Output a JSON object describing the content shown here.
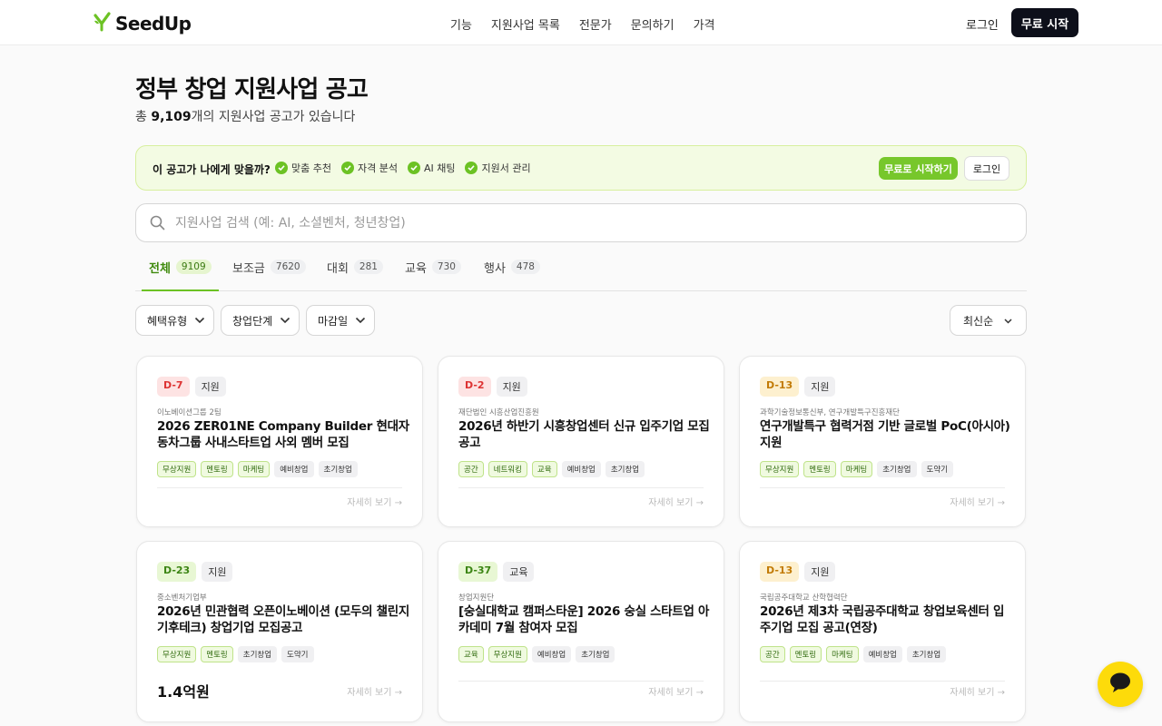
{
  "header": {
    "brand": "SeedUp",
    "nav": [
      "기능",
      "지원사업 목록",
      "전문가",
      "문의하기",
      "가격"
    ],
    "login": "로그인",
    "start": "무료 시작"
  },
  "page": {
    "title": "정부 창업 지원사업 공고",
    "subtitle_prefix": "총 ",
    "subtitle_count": "9,109",
    "subtitle_suffix": "개의 지원사업 공고가 있습니다"
  },
  "promo": {
    "question": "이 공고가 나에게 맞을까?",
    "features": [
      "맞춤 추천",
      "자격 분석",
      "AI 채팅",
      "지원서 관리"
    ],
    "start": "무료로 시작하기",
    "login": "로그인"
  },
  "search": {
    "placeholder": "지원사업 검색 (예: AI, 소셜벤처, 청년창업)"
  },
  "tabs": [
    {
      "label": "전체",
      "count": "9109"
    },
    {
      "label": "보조금",
      "count": "7620"
    },
    {
      "label": "대회",
      "count": "281"
    },
    {
      "label": "교육",
      "count": "730"
    },
    {
      "label": "행사",
      "count": "478"
    }
  ],
  "filters": [
    "혜택유형",
    "창업단계",
    "마감일"
  ],
  "sort": "최신순",
  "colors": {
    "accent": "#6cc224",
    "accent_dark": "#3f8a0d",
    "primary_button": "#0d0f1a",
    "chat": "#fddb0a"
  },
  "cards": [
    {
      "dday": "D-7",
      "dday_color": "red",
      "category": "지원",
      "org": "이노베이션그룹 2팀",
      "title": "2026 ZER01NE Company Builder 현대자동차그룹 사내스타트업 사외 멤버 모집",
      "tags": [
        {
          "t": "무상지원",
          "g": true
        },
        {
          "t": "멘토링",
          "g": true
        },
        {
          "t": "마케팅",
          "g": true
        },
        {
          "t": "예비창업",
          "g": false
        },
        {
          "t": "초기창업",
          "g": false
        }
      ],
      "more": "자세히 보기 →"
    },
    {
      "dday": "D-2",
      "dday_color": "red",
      "category": "지원",
      "org": "재단법인 시흥산업진흥원",
      "title": "2026년 하반기 시흥창업센터 신규 입주기업 모집 공고",
      "tags": [
        {
          "t": "공간",
          "g": true
        },
        {
          "t": "네트워킹",
          "g": true
        },
        {
          "t": "교육",
          "g": true
        },
        {
          "t": "예비창업",
          "g": false
        },
        {
          "t": "초기창업",
          "g": false
        }
      ],
      "more": "자세히 보기 →"
    },
    {
      "dday": "D-13",
      "dday_color": "orange",
      "category": "지원",
      "org": "과학기술정보통신부, 연구개발특구진흥재단",
      "title": "연구개발특구 협력거점 기반 글로벌 PoC(아시아) 지원",
      "tags": [
        {
          "t": "무상지원",
          "g": true
        },
        {
          "t": "멘토링",
          "g": true
        },
        {
          "t": "마케팅",
          "g": true
        },
        {
          "t": "초기창업",
          "g": false
        },
        {
          "t": "도약기",
          "g": false
        }
      ],
      "more": "자세히 보기 →"
    },
    {
      "dday": "D-23",
      "dday_color": "green",
      "category": "지원",
      "org": "중소벤처기업부",
      "title": "2026년 민관협력 오픈이노베이션 (모두의 챌린지 기후테크) 창업기업 모집공고",
      "tags": [
        {
          "t": "무상지원",
          "g": true
        },
        {
          "t": "멘토링",
          "g": true
        },
        {
          "t": "초기창업",
          "g": false
        },
        {
          "t": "도약기",
          "g": false
        }
      ],
      "amount": "1.4억원",
      "more": "자세히 보기 →"
    },
    {
      "dday": "D-37",
      "dday_color": "green",
      "category": "교육",
      "org": "창업지원단",
      "title": "[숭실대학교 캠퍼스타운] 2026 숭실 스타트업 아카데미 7월 참여자 모집",
      "tags": [
        {
          "t": "교육",
          "g": true
        },
        {
          "t": "무상지원",
          "g": true
        },
        {
          "t": "예비창업",
          "g": false
        },
        {
          "t": "초기창업",
          "g": false
        }
      ],
      "more": "자세히 보기 →"
    },
    {
      "dday": "D-13",
      "dday_color": "orange",
      "category": "지원",
      "org": "국립공주대학교 산학협력단",
      "title": "2026년 제3차 국립공주대학교 창업보육센터 입주기업 모집 공고(연장)",
      "tags": [
        {
          "t": "공간",
          "g": true
        },
        {
          "t": "멘토링",
          "g": true
        },
        {
          "t": "마케팅",
          "g": true
        },
        {
          "t": "예비창업",
          "g": false
        },
        {
          "t": "초기창업",
          "g": false
        }
      ],
      "more": "자세히 보기 →"
    }
  ]
}
